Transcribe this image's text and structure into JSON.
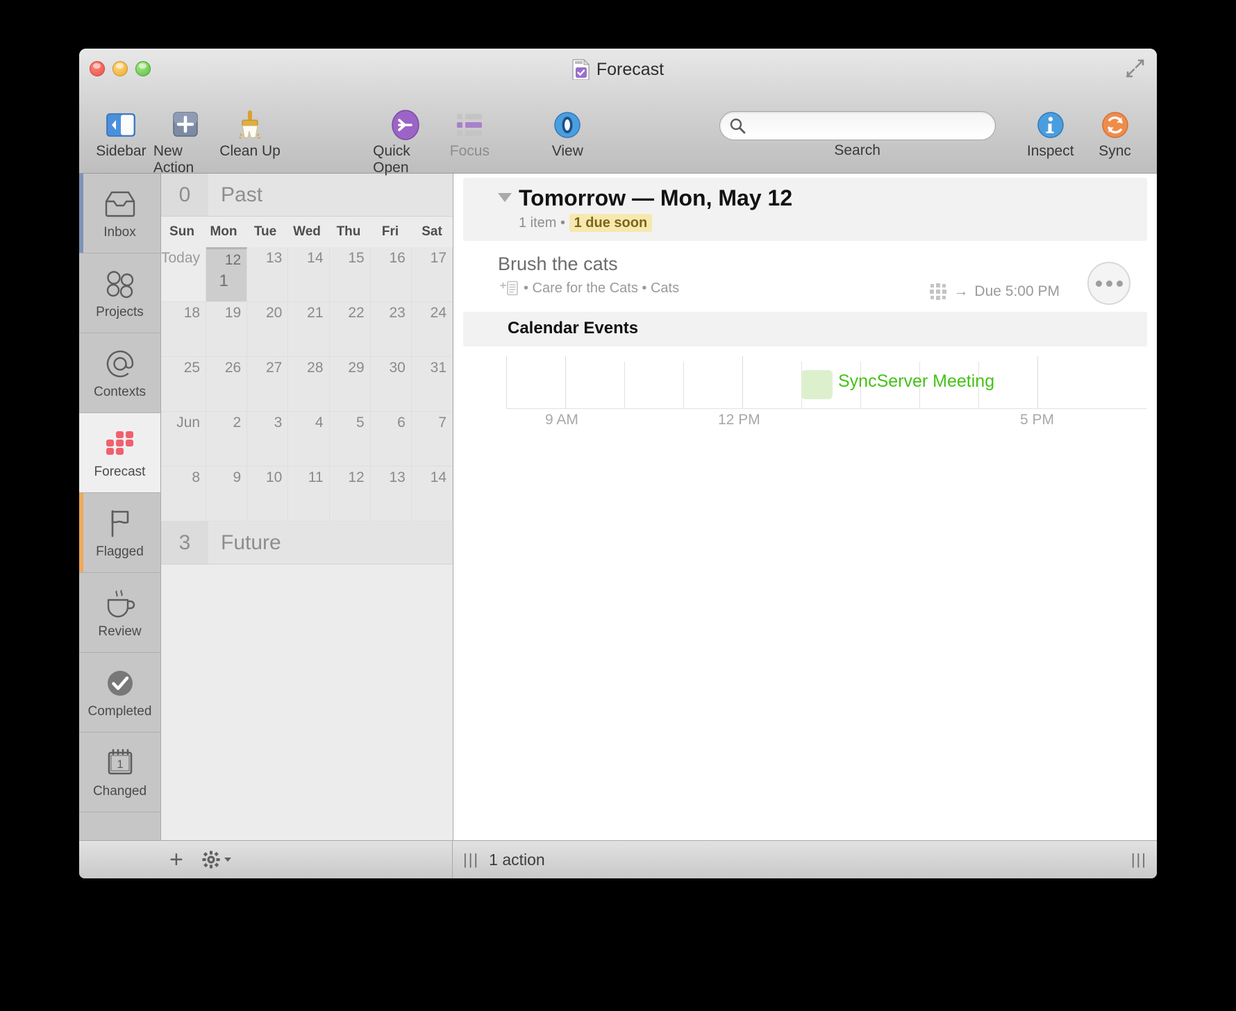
{
  "window": {
    "title": "Forecast",
    "title_icon": "document-checkbox-icon",
    "fullscreen_icon": "fullscreen-icon"
  },
  "toolbar": {
    "items": [
      {
        "label": "Sidebar",
        "icon": "sidebar-icon",
        "dim": false
      },
      {
        "label": "New Action",
        "icon": "plus-square-icon",
        "dim": false
      },
      {
        "label": "Clean Up",
        "icon": "broom-icon",
        "dim": false
      },
      {
        "label": "Quick Open",
        "icon": "arrow-circle-icon",
        "dim": false
      },
      {
        "label": "Focus",
        "icon": "list-icon",
        "dim": true
      },
      {
        "label": "View",
        "icon": "eye-icon",
        "dim": false
      },
      {
        "label": "Inspect",
        "icon": "info-icon",
        "dim": false
      },
      {
        "label": "Sync",
        "icon": "sync-icon",
        "dim": false
      }
    ],
    "search": {
      "label": "Search",
      "value": "",
      "placeholder": "",
      "icon": "search-icon"
    }
  },
  "sidebar": {
    "items": [
      {
        "label": "Inbox",
        "icon": "inbox-icon",
        "selected": false,
        "accent": "#7f92b8"
      },
      {
        "label": "Projects",
        "icon": "projects-icon",
        "selected": false,
        "accent": ""
      },
      {
        "label": "Contexts",
        "icon": "at-icon",
        "selected": false,
        "accent": ""
      },
      {
        "label": "Forecast",
        "icon": "forecast-icon",
        "selected": true,
        "accent": ""
      },
      {
        "label": "Flagged",
        "icon": "flag-icon",
        "selected": false,
        "accent": "#efa košt"
      },
      {
        "label": "Review",
        "icon": "coffee-icon",
        "selected": false,
        "accent": ""
      },
      {
        "label": "Completed",
        "icon": "check-circle-icon",
        "selected": false,
        "accent": ""
      },
      {
        "label": "Changed",
        "icon": "calendar-icon",
        "selected": false,
        "accent": ""
      }
    ]
  },
  "calendar": {
    "past": {
      "count": "0",
      "label": "Past"
    },
    "future": {
      "count": "3",
      "label": "Future"
    },
    "weekday_headers": [
      "Sun",
      "Mon",
      "Tue",
      "Wed",
      "Thu",
      "Fri",
      "Sat"
    ],
    "weeks": [
      [
        {
          "num": "Today",
          "today": true,
          "selected": false,
          "badge": ""
        },
        {
          "num": "12",
          "today": false,
          "selected": true,
          "badge": "1"
        },
        {
          "num": "13",
          "today": false,
          "selected": false,
          "badge": ""
        },
        {
          "num": "14",
          "today": false,
          "selected": false,
          "badge": ""
        },
        {
          "num": "15",
          "today": false,
          "selected": false,
          "badge": ""
        },
        {
          "num": "16",
          "today": false,
          "selected": false,
          "badge": ""
        },
        {
          "num": "17",
          "today": false,
          "selected": false,
          "badge": ""
        }
      ],
      [
        {
          "num": "18",
          "today": false,
          "selected": false,
          "badge": ""
        },
        {
          "num": "19",
          "today": false,
          "selected": false,
          "badge": ""
        },
        {
          "num": "20",
          "today": false,
          "selected": false,
          "badge": ""
        },
        {
          "num": "21",
          "today": false,
          "selected": false,
          "badge": ""
        },
        {
          "num": "22",
          "today": false,
          "selected": false,
          "badge": ""
        },
        {
          "num": "23",
          "today": false,
          "selected": false,
          "badge": ""
        },
        {
          "num": "24",
          "today": false,
          "selected": false,
          "badge": ""
        }
      ],
      [
        {
          "num": "25",
          "today": false,
          "selected": false,
          "badge": ""
        },
        {
          "num": "26",
          "today": false,
          "selected": false,
          "badge": ""
        },
        {
          "num": "27",
          "today": false,
          "selected": false,
          "badge": ""
        },
        {
          "num": "28",
          "today": false,
          "selected": false,
          "badge": ""
        },
        {
          "num": "29",
          "today": false,
          "selected": false,
          "badge": ""
        },
        {
          "num": "30",
          "today": false,
          "selected": false,
          "badge": ""
        },
        {
          "num": "31",
          "today": false,
          "selected": false,
          "badge": ""
        }
      ],
      [
        {
          "num": "Jun",
          "today": false,
          "selected": false,
          "badge": ""
        },
        {
          "num": "2",
          "today": false,
          "selected": false,
          "badge": ""
        },
        {
          "num": "3",
          "today": false,
          "selected": false,
          "badge": ""
        },
        {
          "num": "4",
          "today": false,
          "selected": false,
          "badge": ""
        },
        {
          "num": "5",
          "today": false,
          "selected": false,
          "badge": ""
        },
        {
          "num": "6",
          "today": false,
          "selected": false,
          "badge": ""
        },
        {
          "num": "7",
          "today": false,
          "selected": false,
          "badge": ""
        }
      ],
      [
        {
          "num": "8",
          "today": false,
          "selected": false,
          "badge": ""
        },
        {
          "num": "9",
          "today": false,
          "selected": false,
          "badge": ""
        },
        {
          "num": "10",
          "today": false,
          "selected": false,
          "badge": ""
        },
        {
          "num": "11",
          "today": false,
          "selected": false,
          "badge": ""
        },
        {
          "num": "12",
          "today": false,
          "selected": false,
          "badge": ""
        },
        {
          "num": "13",
          "today": false,
          "selected": false,
          "badge": ""
        },
        {
          "num": "14",
          "today": false,
          "selected": false,
          "badge": ""
        }
      ]
    ]
  },
  "content": {
    "group": {
      "title": "Tomorrow — Mon, May 12",
      "item_count": "1 item",
      "separator": "•",
      "due_soon": "1 due soon"
    },
    "task": {
      "title": "Brush the cats",
      "note_icon": "add-note-icon",
      "meta": "• Care for the Cats • Cats",
      "repeat_icon": "repeat-grid-icon",
      "due_arrow": "→",
      "due": "Due 5:00 PM",
      "more_button": "more-actions-button"
    },
    "calendar_events": {
      "header": "Calendar Events",
      "axis_labels": [
        "9 AM",
        "12 PM",
        "5 PM"
      ],
      "events": [
        {
          "name": "SyncServer Meeting",
          "color": "#45c216",
          "chip_color": "#ddf0ce"
        }
      ]
    }
  },
  "statusbar": {
    "add_label": "+",
    "gear_icon": "gear-dropdown-icon",
    "grip_left": "|||",
    "action_count": "1 action",
    "grip_right": "|||"
  },
  "colors": {
    "accent_blue": "#7f92b8",
    "accent_orange": "#efa85c",
    "forecast_pink": "#f0606e",
    "due_soon_bg": "#f7e8b0",
    "event_green": "#45c216"
  }
}
